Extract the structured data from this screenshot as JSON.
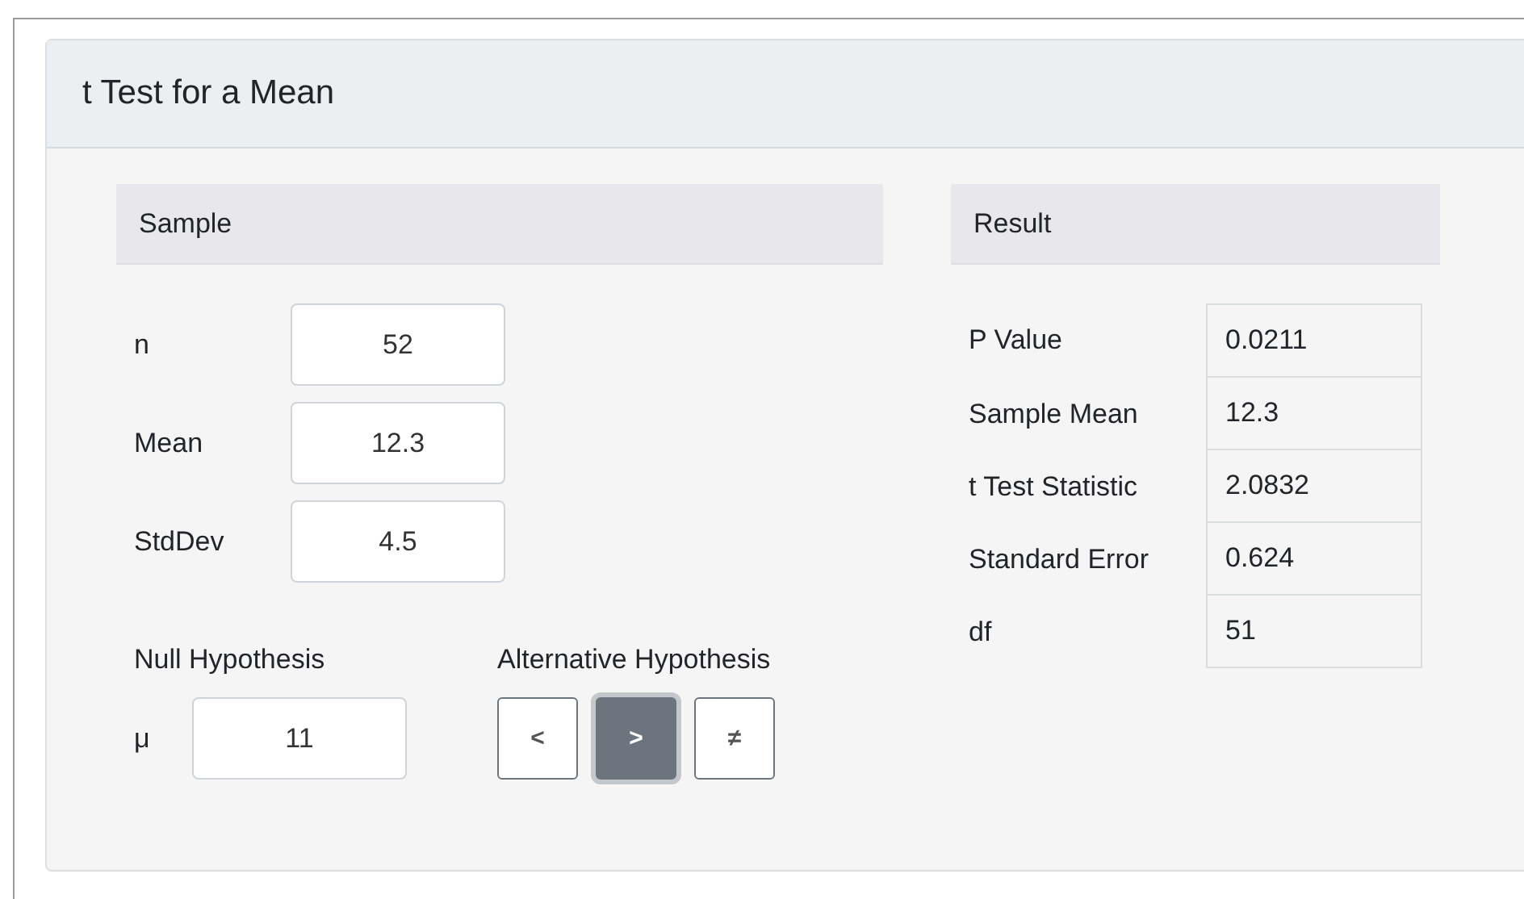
{
  "title": "t Test for a Mean",
  "sample": {
    "heading": "Sample",
    "fields": [
      {
        "label": "n",
        "value": "52"
      },
      {
        "label": "Mean",
        "value": "12.3"
      },
      {
        "label": "StdDev",
        "value": "4.5"
      }
    ]
  },
  "null_hypothesis": {
    "label": "Null Hypothesis",
    "symbol": "μ",
    "value": "11"
  },
  "alternative_hypothesis": {
    "label": "Alternative Hypothesis",
    "options": [
      {
        "label": "<",
        "selected": false
      },
      {
        "label": ">",
        "selected": true
      },
      {
        "label": "≠",
        "selected": false
      }
    ]
  },
  "result": {
    "heading": "Result",
    "rows": [
      {
        "label": "P Value",
        "value": "0.0211"
      },
      {
        "label": "Sample Mean",
        "value": "12.3"
      },
      {
        "label": "t Test Statistic",
        "value": "2.0832"
      },
      {
        "label": "Standard Error",
        "value": "0.624"
      },
      {
        "label": "df",
        "value": "51"
      }
    ]
  }
}
